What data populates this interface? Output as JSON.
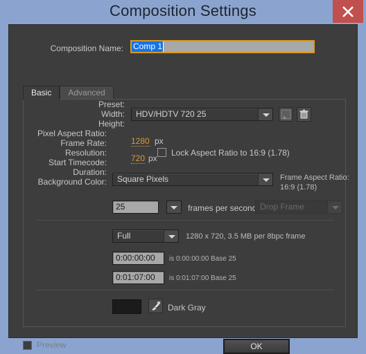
{
  "window": {
    "title": "Composition Settings",
    "close_label": "×",
    "accent_orange": "#d99a22",
    "selection_blue": "#1473e6",
    "close_red": "#c0504d",
    "titlebar_bg": "#8ba4cf",
    "dialog_bg": "#3d3d3d"
  },
  "composition_name": {
    "label": "Composition Name:",
    "value": "Comp 1",
    "selected": true
  },
  "tabs": [
    {
      "label": "Basic",
      "active": true
    },
    {
      "label": "Advanced",
      "active": false
    }
  ],
  "basic": {
    "preset": {
      "label": "Preset:",
      "value": "HDV/HDTV 720 25"
    },
    "preset_buttons": [
      {
        "name": "save-preset-icon",
        "tooltip": "New preset"
      },
      {
        "name": "delete-preset-icon",
        "tooltip": "Delete preset"
      }
    ],
    "width": {
      "label": "Width:",
      "value": "1280",
      "unit": "px"
    },
    "height": {
      "label": "Height:",
      "value": "720",
      "unit": "px"
    },
    "lock_aspect": {
      "label": "Lock Aspect Ratio to 16:9 (1.78)",
      "checked": false
    },
    "pixel_aspect_ratio": {
      "label": "Pixel Aspect Ratio:",
      "value": "Square Pixels"
    },
    "frame_aspect_ratio": {
      "label": "Frame Aspect Ratio:",
      "value": "16:9 (1.78)"
    },
    "frame_rate": {
      "label": "Frame Rate:",
      "value": "25",
      "unit": "frames per second"
    },
    "drop_frame": {
      "value": "Drop Frame",
      "enabled": false
    },
    "resolution": {
      "label": "Resolution:",
      "value": "Full",
      "info": "1280 x 720, 3.5 MB per 8bpc frame"
    },
    "start_timecode": {
      "label": "Start Timecode:",
      "value": "0:00:00:00",
      "info": "is 0:00:00:00  Base 25"
    },
    "duration": {
      "label": "Duration:",
      "value": "0:01:07:00",
      "info": "is 0:01:07:00  Base 25"
    },
    "background_color": {
      "label": "Background Color:",
      "swatch_hex": "#1b1b1b",
      "name": "Dark Gray",
      "eyedropper": "eyedropper-icon"
    }
  },
  "footer": {
    "preview": {
      "label": "Preview",
      "checked": false,
      "enabled": false
    },
    "ok_label": "OK"
  }
}
